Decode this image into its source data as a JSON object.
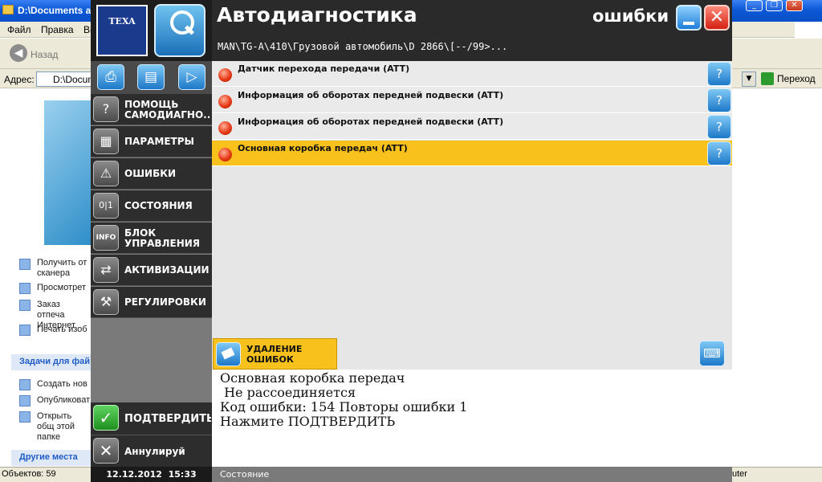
{
  "explorer": {
    "title": "D:\\Documents an",
    "menu": [
      "Файл",
      "Правка",
      "Ви"
    ],
    "back_label": "Назад",
    "address_label": "Адрес:",
    "address_value": "D:\\Docum",
    "go_label": "Переход",
    "links": [
      {
        "label": "Получить от сканера",
        "icon": "scanner-icon"
      },
      {
        "label": "Просмотрет",
        "icon": "slideshow-icon"
      },
      {
        "label": "Заказ отпеча Интернет",
        "icon": "web-order-icon"
      },
      {
        "label": "Печать изоб",
        "icon": "print-icon"
      }
    ],
    "tasks_header": "Задачи для фай",
    "tasks": [
      {
        "label": "Создать нов",
        "icon": "new-folder-icon"
      },
      {
        "label": "Опубликоват",
        "icon": "publish-icon"
      },
      {
        "label": "Открыть общ этой папке",
        "icon": "share-icon"
      }
    ],
    "other_places_header": "Другие места",
    "status_count": "Объектов: 59",
    "status_right": "uter"
  },
  "app": {
    "title": "Автодиагностика",
    "section": "ошибки",
    "vehicle_path": "MAN\\TG-A\\410\\Грузовой автомобиль\\D 2866\\[--/99>...",
    "logo_text": "TEXA",
    "menu": [
      {
        "label": "ПОМОЩЬ\nСАМОДИАГНО...",
        "icon": "help-icon",
        "glyph": "?"
      },
      {
        "label": "ПАРАМЕТРЫ",
        "icon": "grid-icon",
        "glyph": "▦"
      },
      {
        "label": "ОШИБКИ",
        "icon": "warning-icon",
        "glyph": "⚠"
      },
      {
        "label": "СОСТОЯНИЯ",
        "icon": "binary-icon",
        "glyph": "0|1"
      },
      {
        "label": "БЛОК\nУПРАВЛЕНИЯ",
        "icon": "info-icon",
        "glyph": "INFO"
      },
      {
        "label": "АКТИВИЗАЦИИ",
        "icon": "activation-icon",
        "glyph": "⇄"
      },
      {
        "label": "РЕГУЛИРОВКИ",
        "icon": "tools-icon",
        "glyph": "⚒"
      }
    ],
    "confirm_label": "ПОДТВЕРДИТЬ",
    "cancel_label": "Аннулируй",
    "datetime": "12.12.2012  15:33",
    "errors": [
      {
        "text": "Датчик перехода передачи (ATT)",
        "selected": false
      },
      {
        "text": "Информация об оборотах передней подвески (ATT)",
        "selected": false
      },
      {
        "text": "Информация об оборотах передней подвески (ATT)",
        "selected": false
      },
      {
        "text": "Основная коробка передач (ATT)",
        "selected": true
      }
    ],
    "delete_label": "УДАЛЕНИЕ\nОШИБОК",
    "detail_lines": [
      "Основная коробка передач",
      " Не рассоединяется",
      "Код ошибки: 154 Повторы ошибки 1",
      "Нажмите ПОДТВЕРДИТЬ"
    ],
    "status": "Состояние",
    "colors": {
      "selected_row": "#f9c11c",
      "header": "#2a2a2a",
      "sidebar": "#2d2d2d",
      "accent_blue": "#1d78c8"
    }
  }
}
